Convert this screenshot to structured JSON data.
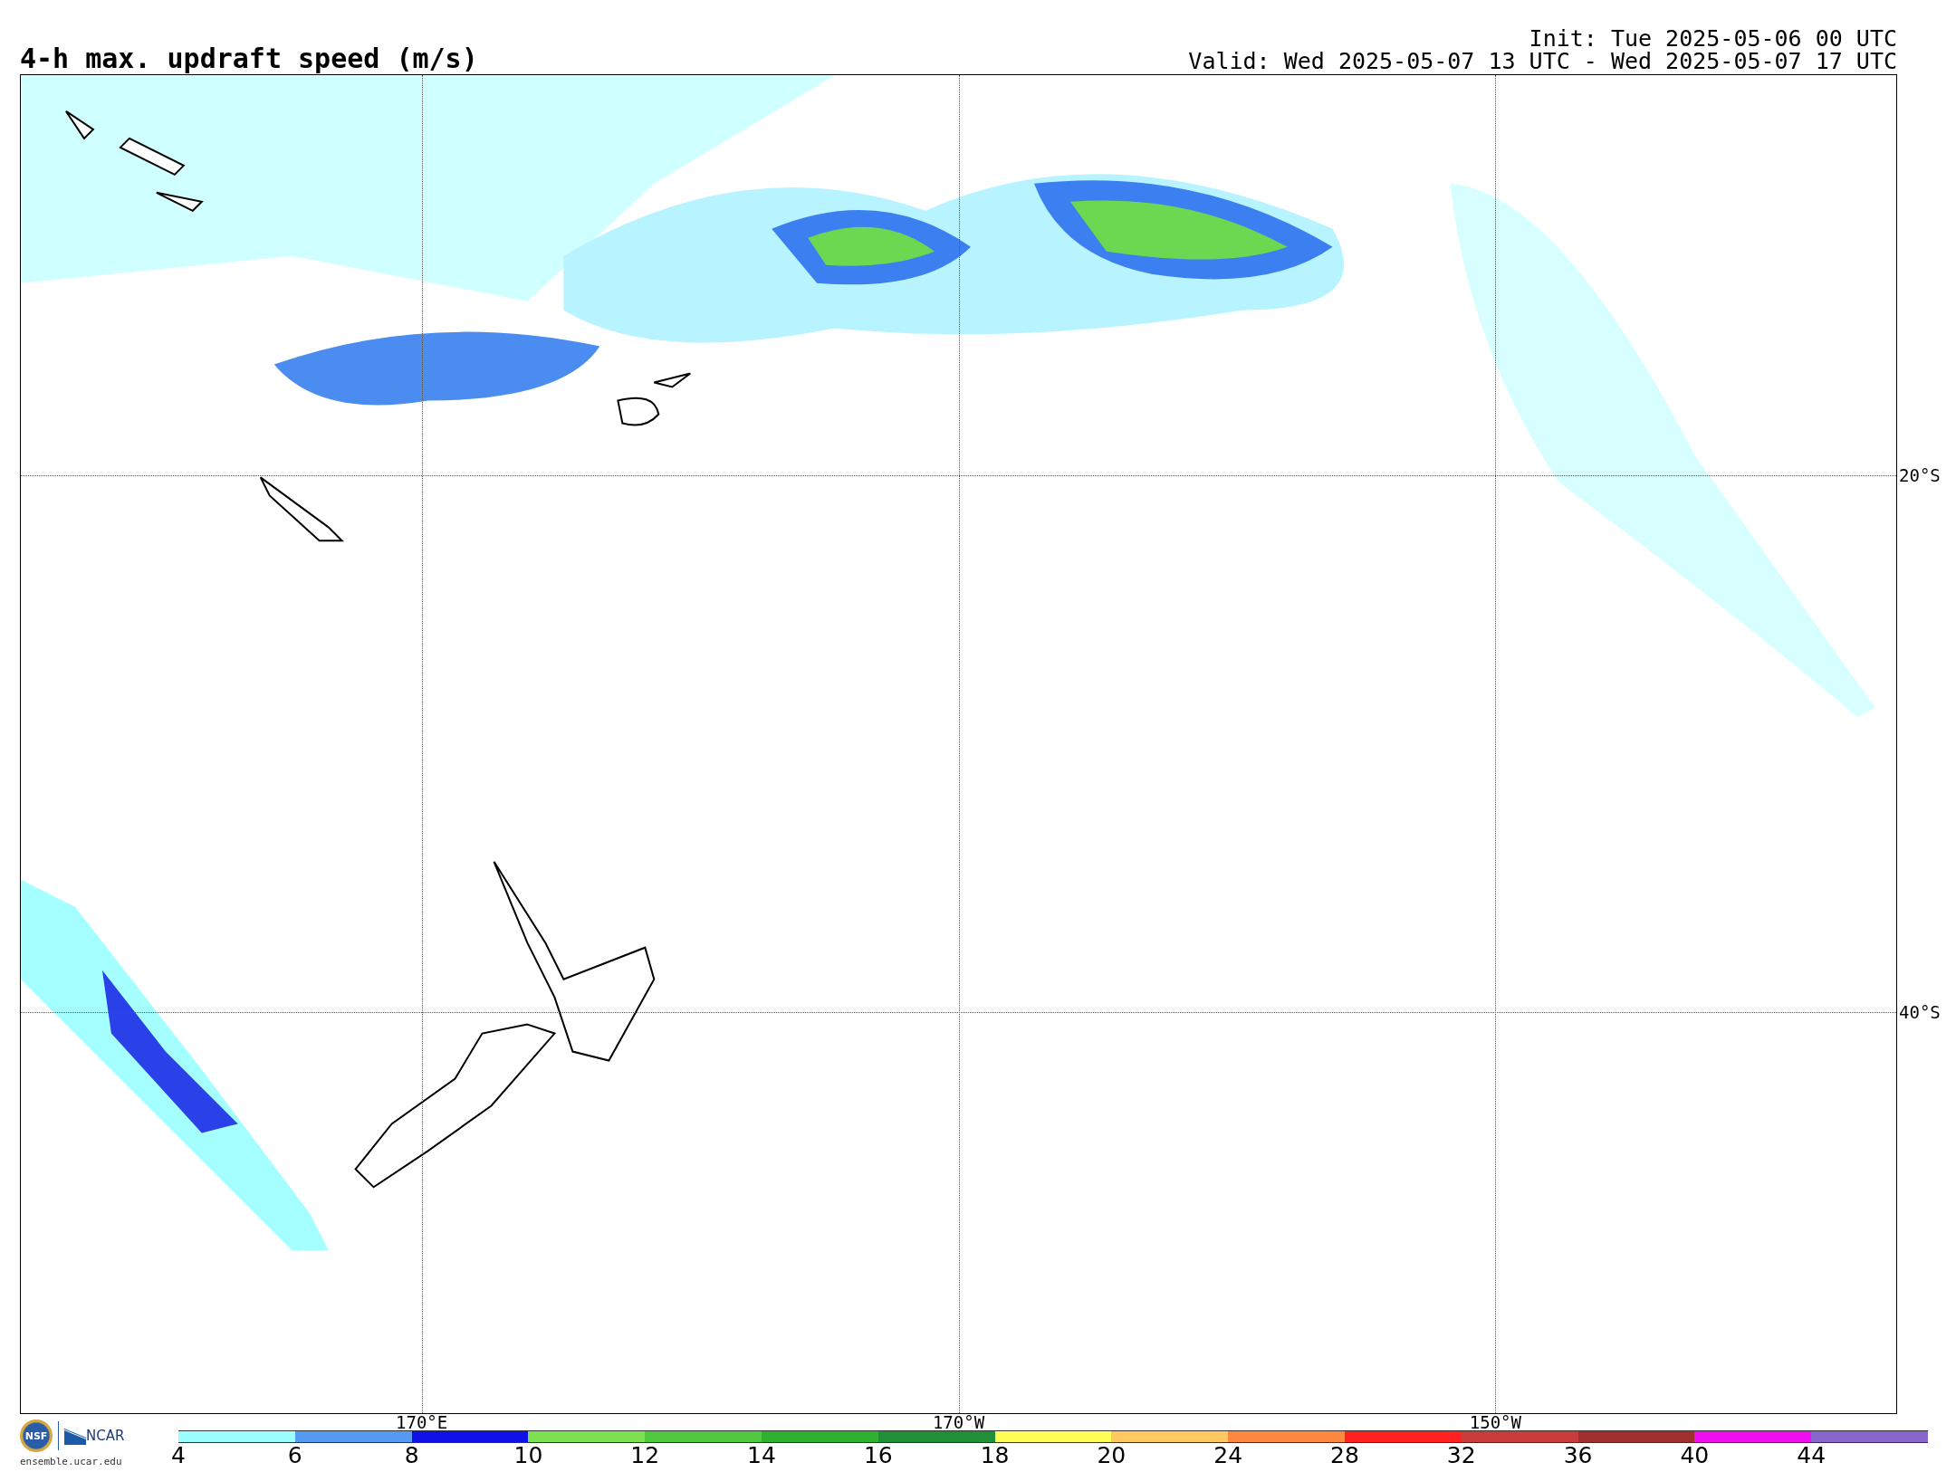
{
  "title": "4-h max. updraft speed (m/s)",
  "init": "Init: Tue 2025-05-06 00 UTC",
  "valid": "Valid: Wed 2025-05-07 13 UTC - Wed 2025-05-07 17 UTC",
  "map": {
    "lat_labels": [
      "20°S",
      "40°S"
    ],
    "lon_labels": [
      "170°E",
      "170°W",
      "150°W"
    ]
  },
  "logo": {
    "nsf": "NSF",
    "ncar": "NCAR",
    "site": "ensemble.ucar.edu"
  },
  "colorbar": [
    {
      "label": "4",
      "color": "#9cffff"
    },
    {
      "label": "6",
      "color": "#5599f0"
    },
    {
      "label": "8",
      "color": "#1010e8"
    },
    {
      "label": "10",
      "color": "#7de050"
    },
    {
      "label": "12",
      "color": "#50c840"
    },
    {
      "label": "14",
      "color": "#30b030"
    },
    {
      "label": "16",
      "color": "#209038"
    },
    {
      "label": "18",
      "color": "#ffff55"
    },
    {
      "label": "20",
      "color": "#ffc860"
    },
    {
      "label": "24",
      "color": "#ff8840"
    },
    {
      "label": "28",
      "color": "#ff2020"
    },
    {
      "label": "32",
      "color": "#c83c3c"
    },
    {
      "label": "36",
      "color": "#a03030"
    },
    {
      "label": "40",
      "color": "#ee10ee"
    },
    {
      "label": "44",
      "color": "#8866cc"
    }
  ]
}
